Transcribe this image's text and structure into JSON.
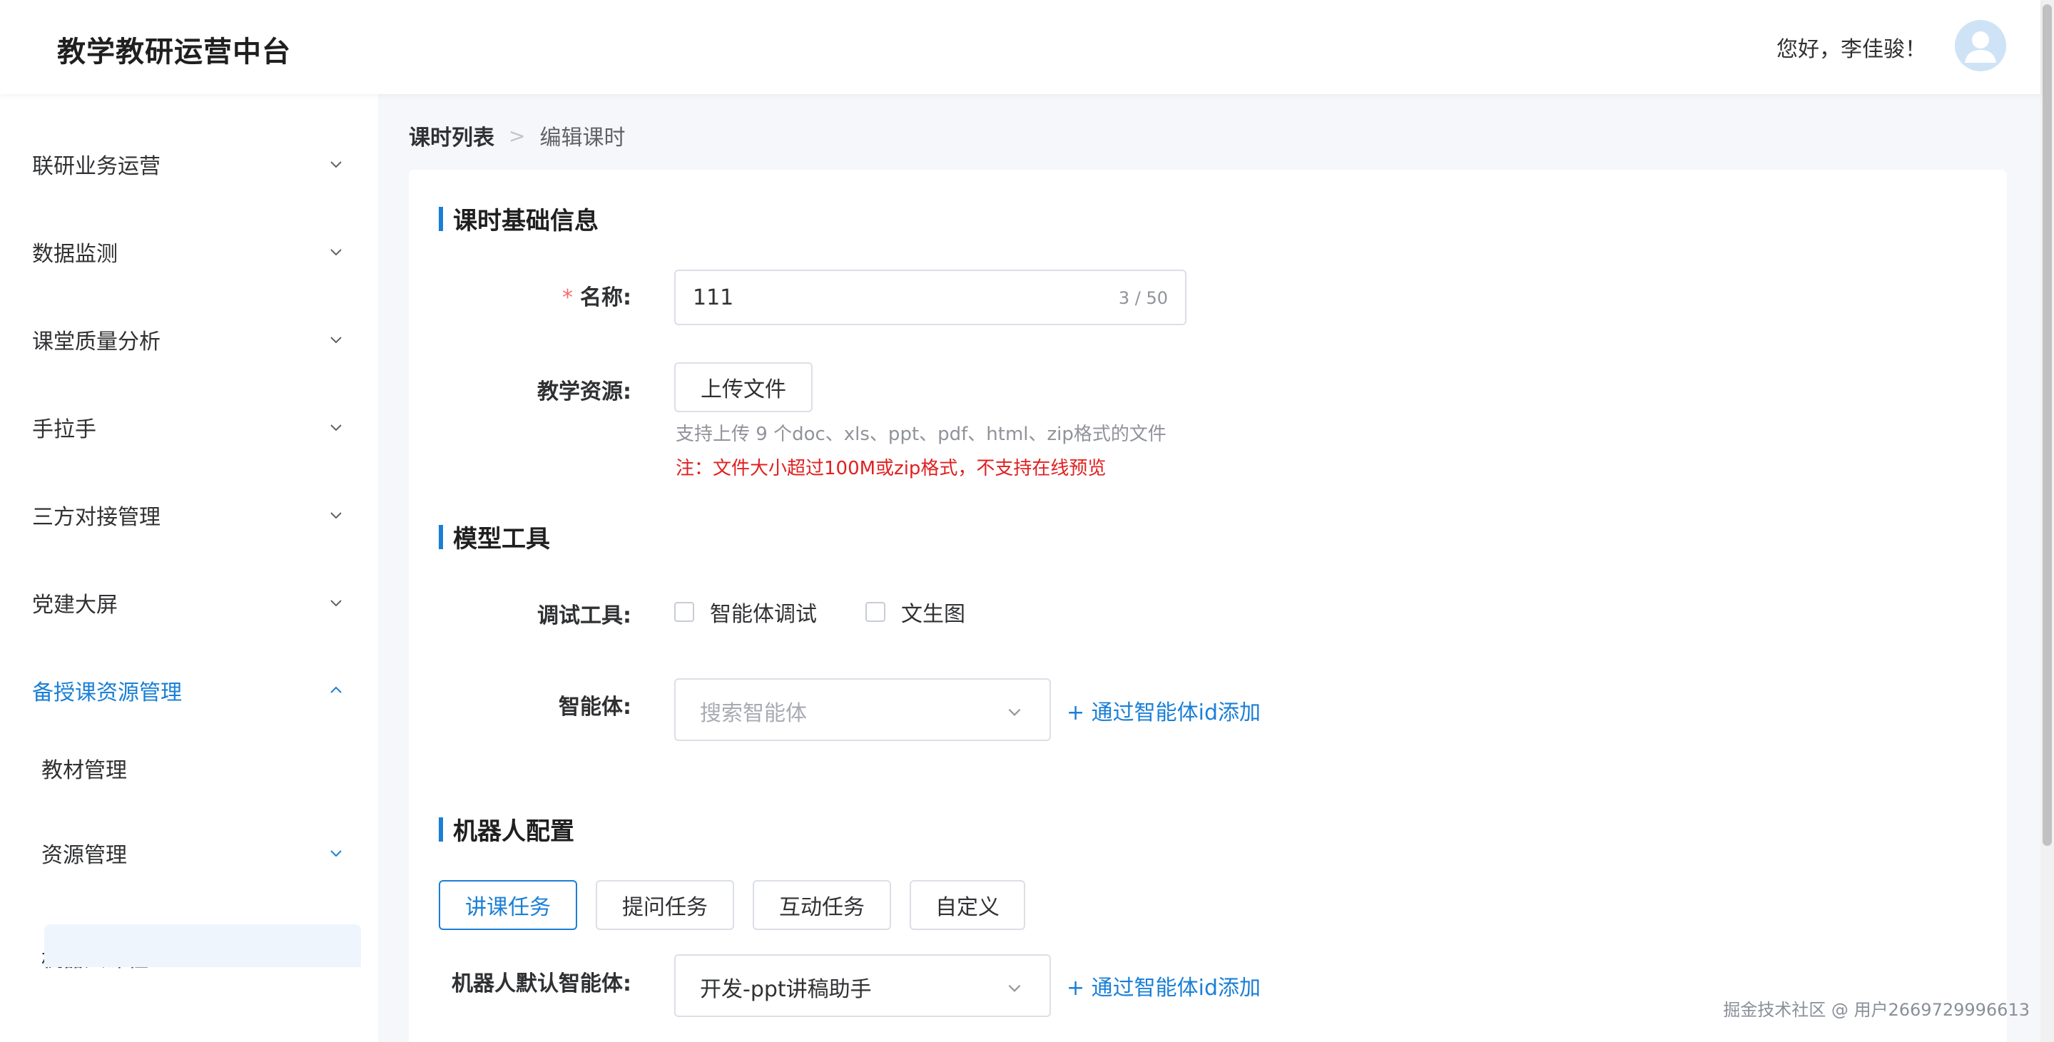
{
  "header": {
    "app_title": "教学教研运营中台",
    "greeting": "您好，李佳骏！",
    "avatar_icon": "user-avatar-icon"
  },
  "sidebar": {
    "items": [
      {
        "label": "联研业务运营",
        "expanded": false
      },
      {
        "label": "数据监测",
        "expanded": false
      },
      {
        "label": "课堂质量分析",
        "expanded": false
      },
      {
        "label": "手拉手",
        "expanded": false
      },
      {
        "label": "三方对接管理",
        "expanded": false
      },
      {
        "label": "党建大屏",
        "expanded": false
      },
      {
        "label": "备授课资源管理",
        "expanded": true,
        "active": true
      }
    ],
    "subitems": [
      {
        "label": "教材管理"
      },
      {
        "label": "资源管理",
        "expanded": false
      },
      {
        "label": "机器人课程",
        "expanded": true
      }
    ],
    "active_color": "#1a7fd6"
  },
  "breadcrumb": {
    "first": "课时列表",
    "sep": ">",
    "second": "编辑课时"
  },
  "sections": {
    "basic": "课时基础信息",
    "model": "模型工具",
    "robot": "机器人配置"
  },
  "form": {
    "name_label": "名称:",
    "name_required": "*",
    "name_value": "111",
    "name_count": "3 / 50",
    "resource_label": "教学资源:",
    "upload_button": "上传文件",
    "upload_hint": "支持上传 9 个doc、xls、ppt、pdf、html、zip格式的文件",
    "upload_warn": "注：文件大小超过100M或zip格式，不支持在线预览",
    "debug_label": "调试工具:",
    "debug_options": [
      "智能体调试",
      "文生图"
    ],
    "agent_label": "智能体:",
    "agent_placeholder": "搜索智能体",
    "add_by_id": "+ 通过智能体id添加",
    "robot_tabs": [
      "讲课任务",
      "提问任务",
      "互动任务",
      "自定义"
    ],
    "robot_default_label": "机器人默认智能体:",
    "robot_default_value": "开发-ppt讲稿助手"
  },
  "watermark": "掘金技术社区 @ 用户2669729996613",
  "colors": {
    "primary": "#1a7fd6",
    "required": "#f56c6c",
    "warning": "#e02020"
  }
}
